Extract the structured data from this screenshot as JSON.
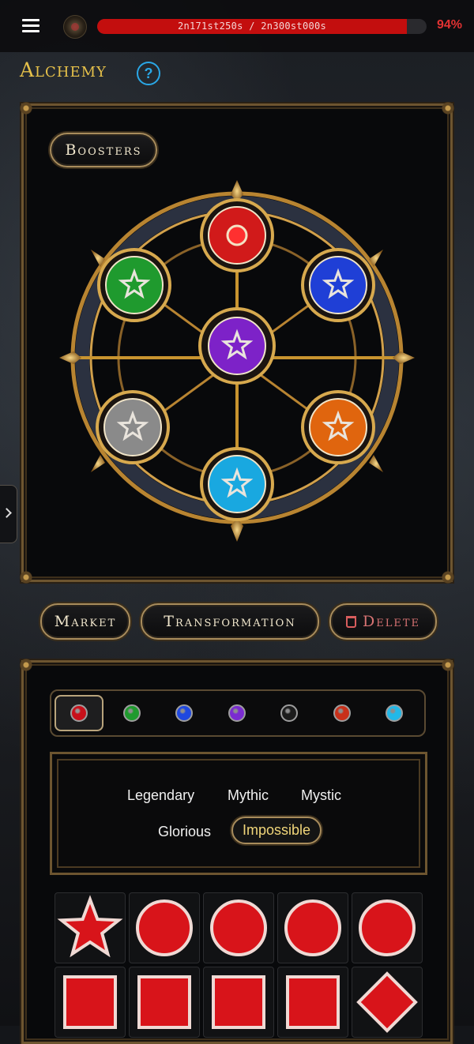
{
  "header": {
    "progress_text": "2n171st250s / 2n300st000s",
    "progress_percent_label": "94%",
    "progress_fraction": 0.94,
    "menu_icon": "hamburger-icon",
    "logo_icon": "game-logo-icon"
  },
  "page": {
    "title": "Alchemy",
    "help_icon": "question-icon",
    "help_glyph": "?"
  },
  "alchemy": {
    "boosters_label": "Boosters",
    "orbs": [
      {
        "name": "red",
        "color": "#d11a1a"
      },
      {
        "name": "green",
        "color": "#1f9a2e"
      },
      {
        "name": "blue",
        "color": "#1f3fd6"
      },
      {
        "name": "purple",
        "color": "#7d22c8"
      },
      {
        "name": "silver",
        "color": "#8a8a8a"
      },
      {
        "name": "orange",
        "color": "#e0650e"
      },
      {
        "name": "cyan",
        "color": "#19a8e0"
      }
    ]
  },
  "actions": {
    "market_label": "Market",
    "transformation_label": "Transformation",
    "delete_label": "Delete",
    "delete_icon": "trash-icon"
  },
  "gem_tabs": [
    {
      "name": "red",
      "color": "#c8101a",
      "selected": true
    },
    {
      "name": "green",
      "color": "#1f9a2e",
      "selected": false
    },
    {
      "name": "blue",
      "color": "#1f48e0",
      "selected": false
    },
    {
      "name": "purple",
      "color": "#7a2bd0",
      "selected": false
    },
    {
      "name": "black",
      "color": "#1c1c1c",
      "selected": false
    },
    {
      "name": "orange-red",
      "color": "#c8301a",
      "selected": false
    },
    {
      "name": "cyan",
      "color": "#22b8e8",
      "selected": false
    }
  ],
  "rarities": {
    "legendary": "Legendary",
    "mythic": "Mythic",
    "mystic": "Mystic",
    "glorious": "Glorious",
    "impossible": "Impossible",
    "active": "impossible"
  },
  "items": [
    {
      "shape": "star"
    },
    {
      "shape": "round"
    },
    {
      "shape": "round"
    },
    {
      "shape": "round"
    },
    {
      "shape": "round"
    },
    {
      "shape": "square"
    },
    {
      "shape": "square"
    },
    {
      "shape": "square"
    },
    {
      "shape": "square"
    },
    {
      "shape": "diamond"
    }
  ]
}
